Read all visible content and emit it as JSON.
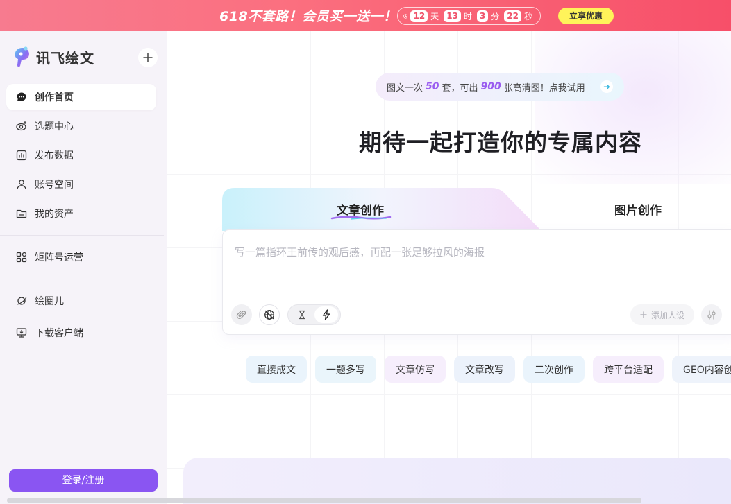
{
  "banner": {
    "title": "618不套路！会员买一送一！",
    "countdown": [
      {
        "value": "12",
        "unit": "天"
      },
      {
        "value": "13",
        "unit": "时"
      },
      {
        "value": "3",
        "unit": "分"
      },
      {
        "value": "22",
        "unit": "秒"
      }
    ],
    "cta_label": "立享优惠",
    "cta_color": "#fff35a"
  },
  "sidebar": {
    "logo_text": "讯飞绘文",
    "new_icon": "plus-icon",
    "items": [
      {
        "label": "创作首页",
        "icon": "chat-bubble-icon",
        "active": true
      },
      {
        "label": "选题中心",
        "icon": "eye-sparkle-icon",
        "active": false
      },
      {
        "label": "发布数据",
        "icon": "bar-chart-icon",
        "active": false
      },
      {
        "label": "账号空间",
        "icon": "user-icon",
        "active": false
      },
      {
        "label": "我的资产",
        "icon": "folder-icon",
        "active": false
      },
      {
        "label": "矩阵号运营",
        "icon": "grid-icon",
        "active": false
      },
      {
        "label": "绘圈儿",
        "icon": "planet-icon",
        "active": false
      },
      {
        "label": "下载客户端",
        "icon": "monitor-download-icon",
        "active": false
      }
    ],
    "login_label": "登录/注册",
    "accent_color": "#8a55f2"
  },
  "main": {
    "promo": {
      "prefix": "图文一次",
      "count1": "50",
      "mid1": "套，可出",
      "count2": "900",
      "suffix": "张高清图！点我试用"
    },
    "headline": "期待一起打造你的专属内容",
    "tabs": [
      {
        "label": "文章创作",
        "active": true
      },
      {
        "label": "图片创作",
        "active": false
      }
    ],
    "editor": {
      "placeholder": "写一篇指环王前传的观后感，再配一张足够拉风的海报",
      "persona_label": "添加人设"
    },
    "chips": [
      "直接成文",
      "一题多写",
      "文章仿写",
      "文章改写",
      "二次创作",
      "跨平台适配",
      "GEO内容创作"
    ]
  }
}
